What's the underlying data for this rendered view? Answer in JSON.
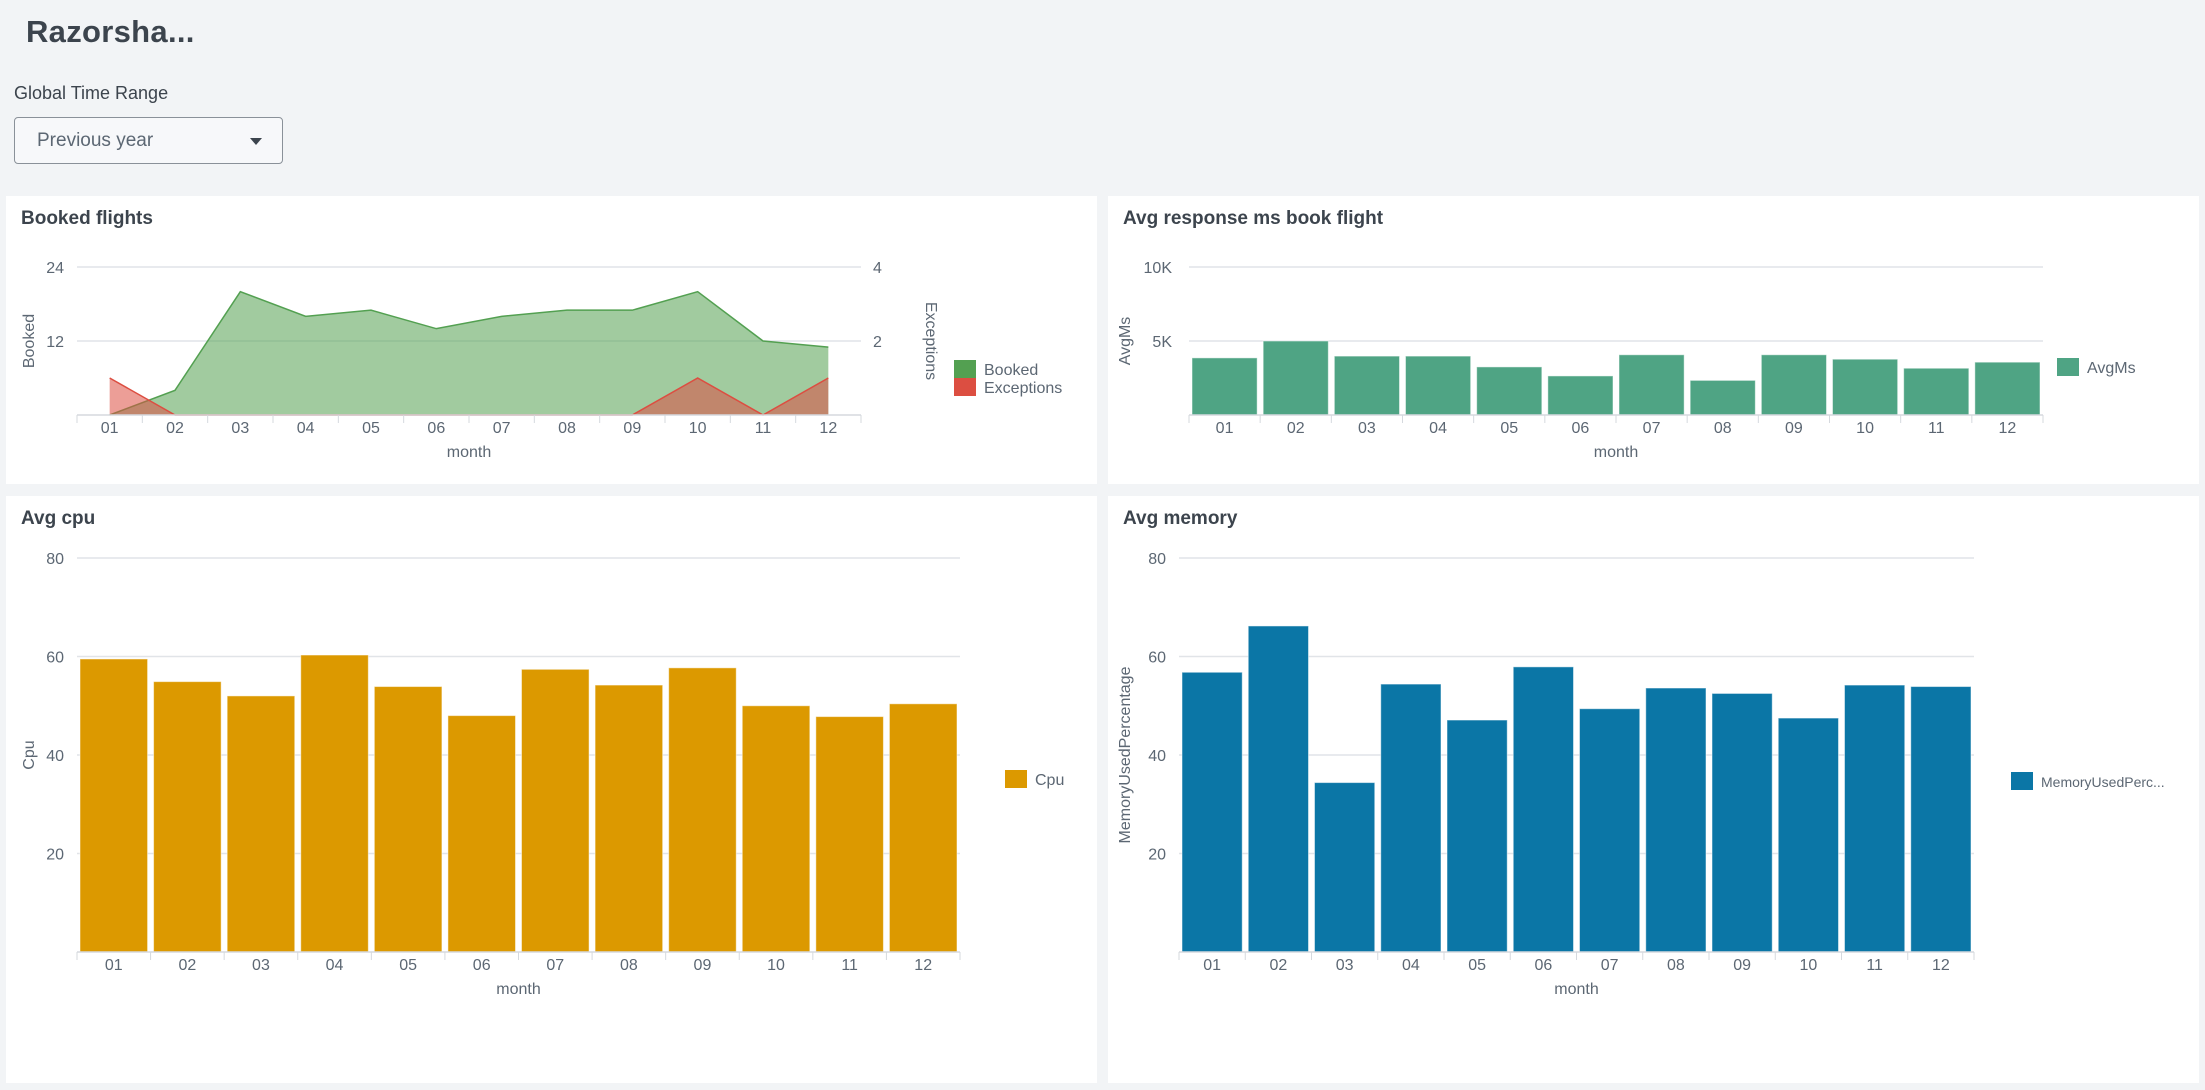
{
  "dashboard": {
    "title": "Razorsha...",
    "time_range_label": "Global Time Range",
    "time_range_value": "Previous year"
  },
  "colors": {
    "booked": "#53a051",
    "exceptions": "#dc4e41",
    "avgms": "#4fa484",
    "cpu": "#dc9900",
    "memory": "#0b76a6"
  },
  "panels": [
    {
      "title": "Booked flights"
    },
    {
      "title": "Avg response ms book flight"
    },
    {
      "title": "Avg cpu"
    },
    {
      "title": "Avg memory"
    }
  ],
  "chart_data": [
    {
      "type": "area",
      "title": "Booked flights",
      "xlabel": "month",
      "ylabel": "Booked",
      "y2label": "Exceptions",
      "categories": [
        "01",
        "02",
        "03",
        "04",
        "05",
        "06",
        "07",
        "08",
        "09",
        "10",
        "11",
        "12"
      ],
      "ylim": [
        0,
        24
      ],
      "yticks": [
        "12",
        "24"
      ],
      "y2lim": [
        0,
        4
      ],
      "y2ticks": [
        "2",
        "4"
      ],
      "series": [
        {
          "name": "Booked",
          "axis": "left",
          "values": [
            0,
            4,
            20,
            16,
            17,
            14,
            16,
            17,
            17,
            20,
            12,
            11
          ]
        },
        {
          "name": "Exceptions",
          "axis": "right",
          "values": [
            1,
            0,
            0,
            0,
            0,
            0,
            0,
            0,
            0,
            1,
            0,
            1
          ]
        }
      ],
      "legend": "right",
      "grid": true
    },
    {
      "type": "bar",
      "title": "Avg response ms book flight",
      "xlabel": "month",
      "ylabel": "AvgMs",
      "categories": [
        "01",
        "02",
        "03",
        "04",
        "05",
        "06",
        "07",
        "08",
        "09",
        "10",
        "11",
        "12"
      ],
      "ylim": [
        0,
        10000
      ],
      "yticks": [
        "5K",
        "10K"
      ],
      "series": [
        {
          "name": "AvgMs",
          "values": [
            3860,
            5000,
            3980,
            3980,
            3250,
            2640,
            4070,
            2340,
            4070,
            3770,
            3160,
            3570
          ]
        }
      ],
      "legend": "right",
      "grid": true
    },
    {
      "type": "bar",
      "title": "Avg cpu",
      "xlabel": "month",
      "ylabel": "Cpu",
      "categories": [
        "01",
        "02",
        "03",
        "04",
        "05",
        "06",
        "07",
        "08",
        "09",
        "10",
        "11",
        "12"
      ],
      "ylim": [
        0,
        80
      ],
      "yticks": [
        "20",
        "40",
        "60",
        "80"
      ],
      "series": [
        {
          "name": "Cpu",
          "values": [
            59.5,
            54.9,
            52.0,
            60.3,
            53.9,
            48.0,
            57.4,
            54.2,
            57.7,
            50.0,
            47.8,
            50.4
          ]
        }
      ],
      "legend": "right",
      "grid": true
    },
    {
      "type": "bar",
      "title": "Avg memory",
      "xlabel": "month",
      "ylabel": "MemoryUsedPercentage",
      "categories": [
        "01",
        "02",
        "03",
        "04",
        "05",
        "06",
        "07",
        "08",
        "09",
        "10",
        "11",
        "12"
      ],
      "ylim": [
        0,
        80
      ],
      "yticks": [
        "20",
        "40",
        "60",
        "80"
      ],
      "series": [
        {
          "name": "MemoryUsedPercentage",
          "legend_label": "MemoryUsedPerc...",
          "values": [
            56.8,
            66.2,
            34.4,
            54.4,
            47.1,
            57.9,
            49.4,
            53.6,
            52.5,
            47.5,
            54.2,
            53.9
          ]
        }
      ],
      "legend": "right",
      "grid": true
    }
  ]
}
